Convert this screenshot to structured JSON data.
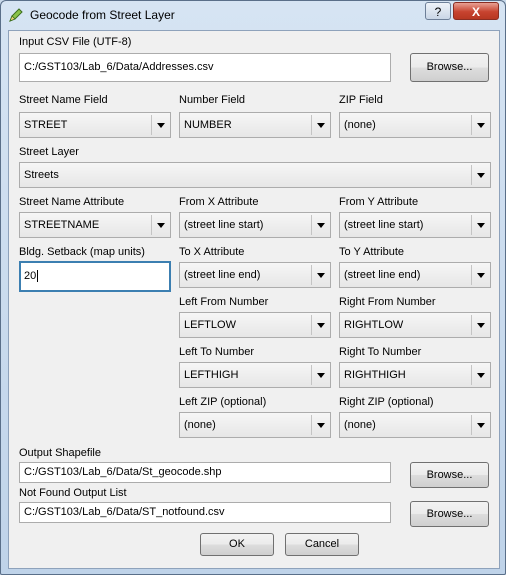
{
  "window": {
    "title": "Geocode from Street Layer",
    "help_label": "?",
    "close_label": "X"
  },
  "input_csv": {
    "label": "Input CSV File (UTF-8)",
    "value": "C:/GST103/Lab_6/Data/Addresses.csv",
    "browse_label": "Browse..."
  },
  "street_name_field": {
    "label": "Street Name Field",
    "value": "STREET"
  },
  "number_field": {
    "label": "Number Field",
    "value": "NUMBER"
  },
  "zip_field": {
    "label": "ZIP Field",
    "value": "(none)"
  },
  "street_layer": {
    "label": "Street Layer",
    "value": "Streets"
  },
  "street_name_attribute": {
    "label": "Street Name Attribute",
    "value": "STREETNAME"
  },
  "from_x_attribute": {
    "label": "From X Attribute",
    "value": "(street line start)"
  },
  "from_y_attribute": {
    "label": "From Y Attribute",
    "value": "(street line start)"
  },
  "setback": {
    "label": "Bldg. Setback (map units)",
    "value": "20"
  },
  "to_x_attribute": {
    "label": "To X Attribute",
    "value": "(street line end)"
  },
  "to_y_attribute": {
    "label": "To Y Attribute",
    "value": "(street line end)"
  },
  "left_from_number": {
    "label": "Left From Number",
    "value": "LEFTLOW"
  },
  "right_from_number": {
    "label": "Right From Number",
    "value": "RIGHTLOW"
  },
  "left_to_number": {
    "label": "Left To Number",
    "value": "LEFTHIGH"
  },
  "right_to_number": {
    "label": "Right To Number",
    "value": "RIGHTHIGH"
  },
  "left_zip": {
    "label": "Left ZIP (optional)",
    "value": "(none)"
  },
  "right_zip": {
    "label": "Right ZIP (optional)",
    "value": "(none)"
  },
  "output_shapefile": {
    "label": "Output Shapefile",
    "value": "C:/GST103/Lab_6/Data/St_geocode.shp",
    "browse_label": "Browse..."
  },
  "not_found_list": {
    "label": "Not Found Output List",
    "value": "C:/GST103/Lab_6/Data/ST_notfound.csv",
    "browse_label": "Browse..."
  },
  "actions": {
    "ok_label": "OK",
    "cancel_label": "Cancel"
  },
  "icons": {
    "app": "qgis-pencil-icon",
    "dropdown": "chevron-down-icon"
  }
}
